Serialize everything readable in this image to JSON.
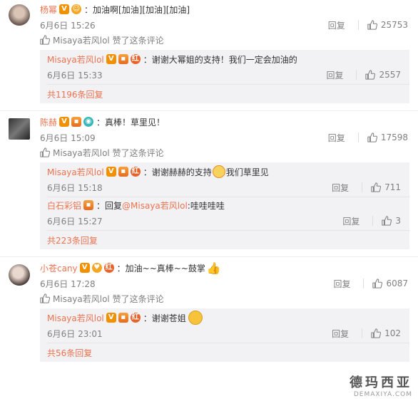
{
  "comments": [
    {
      "username": "杨幂",
      "text": "：加油啊[加油][加油][加油]",
      "time": "6月6日 15:26",
      "reply_label": "回复",
      "likes": "25753",
      "liked_by": "Misaya若风lol 赞了这条评论",
      "replies": [
        {
          "username": "Misaya若风lol",
          "text": "：谢谢大幂姐的支持！我们一定会加油的",
          "time": "6月6日 15:33",
          "reply_label": "回复",
          "likes": "2557"
        }
      ],
      "more": "共1196条回复"
    },
    {
      "username": "陈赫",
      "text": "：真棒！草里见！",
      "time": "6月6日 15:09",
      "reply_label": "回复",
      "likes": "17598",
      "liked_by": "Misaya若风lol 赞了这条评论",
      "replies": [
        {
          "username": "Misaya若风lol",
          "text_a": "：谢谢赫赫的支持",
          "text_b": "我们草里见",
          "time": "6月6日 15:18",
          "reply_label": "回复",
          "likes": "711"
        },
        {
          "username": "白石彩铝",
          "text_a": "：回复",
          "mention": "@Misaya若风lol",
          "text_b": ":哇哇哇哇",
          "time": "6月6日 15:27",
          "reply_label": "回复",
          "likes": "3"
        }
      ],
      "more": "共223条回复"
    },
    {
      "username": "小苍cany",
      "text": "：加油~~真棒~~鼓掌",
      "time": "6月6日 17:28",
      "reply_label": "回复",
      "likes": "6087",
      "liked_by": "Misaya若风lol 赞了这条评论",
      "replies": [
        {
          "username": "Misaya若风lol",
          "text": "：谢谢苍姐",
          "time": "6月6日 23:01",
          "reply_label": "回复",
          "likes": "102"
        }
      ],
      "more": "共56条回复"
    }
  ],
  "watermark": {
    "line1": "德玛西亚",
    "line2": "DEMAXIYA.COM"
  },
  "colors": {
    "link": "#eb7350",
    "meta": "#808080",
    "reply_bg": "#f2f2f5"
  },
  "icons": [
    "thumb-up-icon",
    "verified-v-icon",
    "member-badge-icon",
    "level-badge-icon",
    "emoji-icon"
  ]
}
